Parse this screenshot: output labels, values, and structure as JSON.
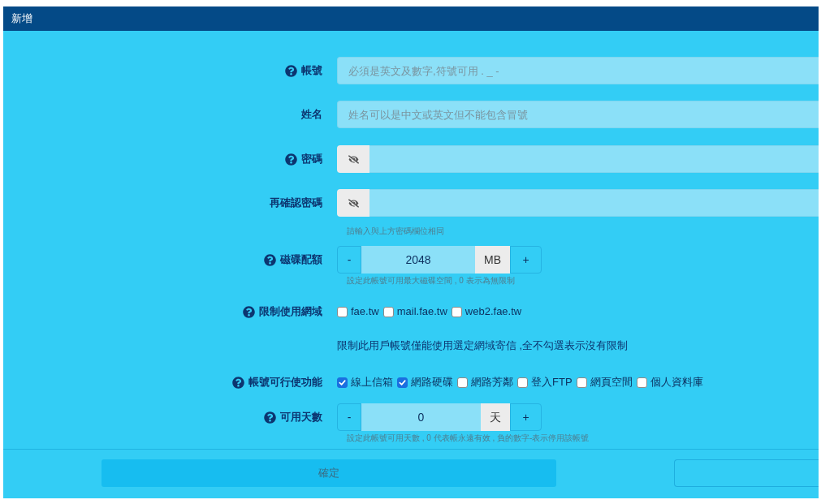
{
  "dialog": {
    "title": "新增"
  },
  "fields": [
    {
      "kind": "text",
      "label": "帳號",
      "help": true,
      "placeholder": "必須是英文及數字,符號可用 . _ -"
    },
    {
      "kind": "text",
      "label": "姓名",
      "help": false,
      "placeholder": "姓名可以是中文或英文但不能包含冒號"
    },
    {
      "kind": "password",
      "label": "密碼",
      "help": true
    },
    {
      "kind": "password",
      "label": "再確認密碼",
      "help": false,
      "hint": "請輸入與上方密碼欄位相同"
    },
    {
      "kind": "stepper",
      "label": "磁碟配額",
      "help": true,
      "decrement": "-",
      "value": "2048",
      "unit": "MB",
      "increment": "+",
      "hint": "設定此帳號可用最大磁碟空間 , 0 表示為無限制"
    },
    {
      "kind": "checkboxes",
      "label": "限制使用網域",
      "help": true,
      "options": [
        {
          "label": "fae.tw",
          "checked": false
        },
        {
          "label": "mail.fae.tw",
          "checked": false
        },
        {
          "label": "web2.fae.tw",
          "checked": false
        }
      ],
      "note": "限制此用戶帳號僅能使用選定網域寄信 ,全不勾選表示沒有限制"
    },
    {
      "kind": "checkboxes",
      "label": "帳號可行使功能",
      "help": true,
      "options": [
        {
          "label": "線上信箱",
          "checked": true
        },
        {
          "label": "網路硬碟",
          "checked": true
        },
        {
          "label": "網路芳鄰",
          "checked": false
        },
        {
          "label": "登入FTP",
          "checked": false
        },
        {
          "label": "網頁空間",
          "checked": false
        },
        {
          "label": "個人資料庫",
          "checked": false
        }
      ]
    },
    {
      "kind": "stepper",
      "label": "可用天數",
      "help": true,
      "decrement": "-",
      "value": "0",
      "unit": "天",
      "increment": "+",
      "hint": "設定此帳號可用天數 , 0 代表帳永遠有效 , 負的數字-表示停用該帳號"
    }
  ],
  "footer": {
    "buttons": [
      {
        "kind": "primary",
        "label": "確定"
      },
      {
        "kind": "outline"
      }
    ]
  }
}
